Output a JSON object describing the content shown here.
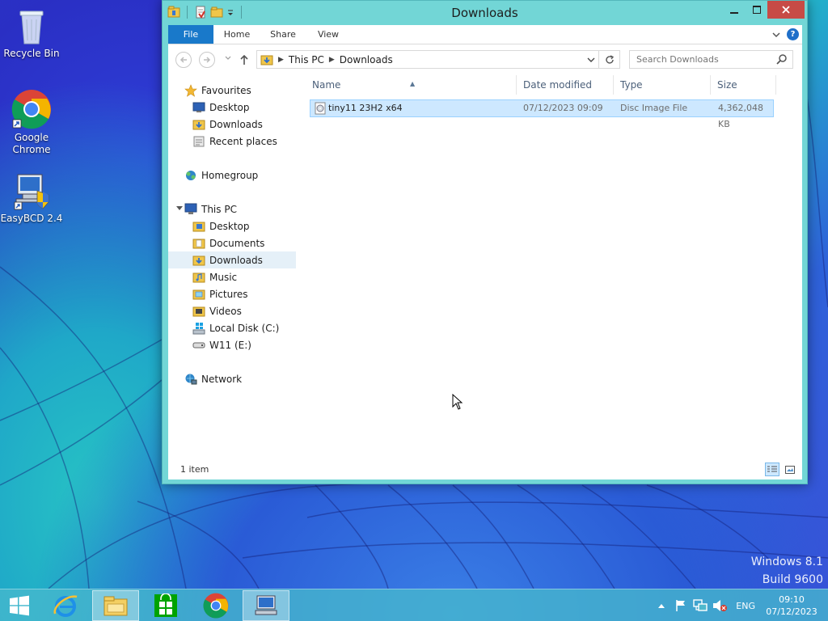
{
  "desktop": {
    "icons": [
      {
        "label": "Recycle Bin"
      },
      {
        "label": "Google Chrome"
      },
      {
        "label": "EasyBCD 2.4"
      }
    ],
    "watermark": {
      "line1": "Windows 8.1",
      "line2": "Build 9600"
    }
  },
  "explorer": {
    "title": "Downloads",
    "ribbon_tabs": [
      "File",
      "Home",
      "Share",
      "View"
    ],
    "address": {
      "crumbs": [
        "This PC",
        "Downloads"
      ]
    },
    "search": {
      "placeholder": "Search Downloads"
    },
    "nav": {
      "favourites": {
        "label": "Favourites",
        "items": [
          "Desktop",
          "Downloads",
          "Recent places"
        ]
      },
      "homegroup": {
        "label": "Homegroup"
      },
      "this_pc": {
        "label": "This PC",
        "items": [
          "Desktop",
          "Documents",
          "Downloads",
          "Music",
          "Pictures",
          "Videos",
          "Local Disk (C:)",
          "W11 (E:)"
        ]
      },
      "network": {
        "label": "Network"
      }
    },
    "columns": {
      "name": "Name",
      "date": "Date modified",
      "type": "Type",
      "size": "Size"
    },
    "files": [
      {
        "name": "tiny11 23H2 x64",
        "date": "07/12/2023 09:09",
        "type": "Disc Image File",
        "size": "4,362,048 KB"
      }
    ],
    "status": "1 item"
  },
  "taskbar": {
    "tray": {
      "lang": "ENG",
      "time": "09:10",
      "date": "07/12/2023"
    }
  },
  "colors": {
    "accent": "#1979ca",
    "close": "#c74b46",
    "selection": "#cde8ff",
    "window_frame": "#72d6d6"
  }
}
